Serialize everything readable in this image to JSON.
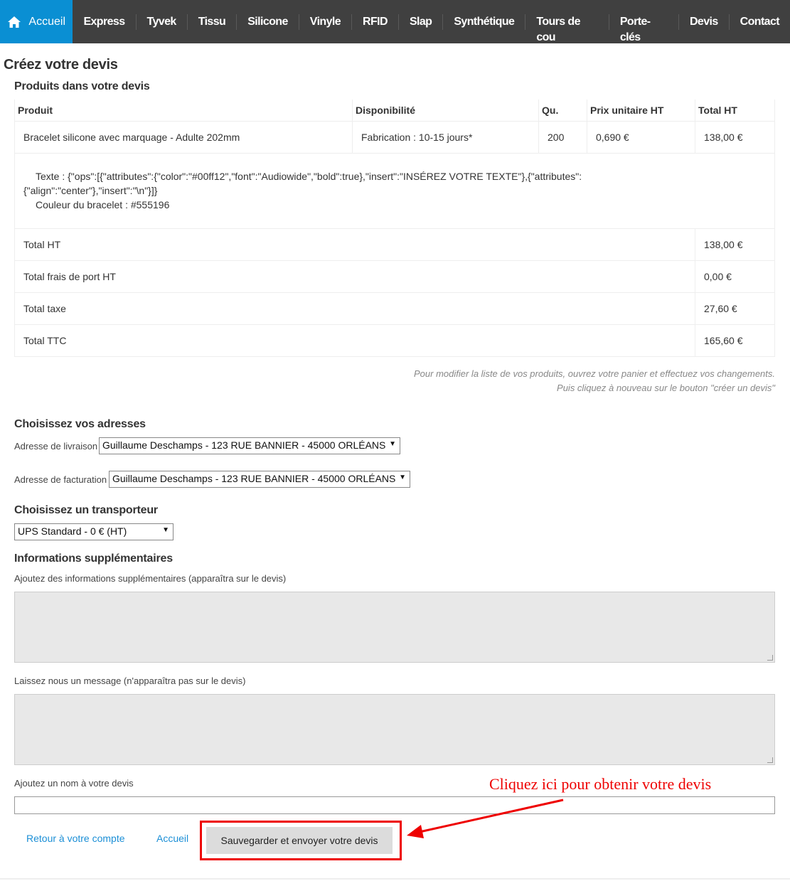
{
  "nav": {
    "home": "Accueil",
    "items": [
      "Express",
      "Tyvek",
      "Tissu",
      "Silicone",
      "Vinyle",
      "RFID",
      "Slap",
      "Synthétique",
      "Tours de cou",
      "Porte-clés",
      "Devis",
      "Contact"
    ]
  },
  "page_title": "Créez votre devis",
  "products_title": "Produits dans votre devis",
  "table": {
    "headers": [
      "Produit",
      "Disponibilité",
      "Qu.",
      "Prix unitaire HT",
      "Total HT"
    ],
    "row": [
      "Bracelet silicone avec marquage - Adulte 202mm",
      "Fabrication : 10-15 jours*",
      "200",
      "0,690 €",
      "138,00 €"
    ],
    "options_line1": "Texte : {\"ops\":[{\"attributes\":{\"color\":\"#00ff12\",\"font\":\"Audiowide\",\"bold\":true},\"insert\":\"INSÉREZ VOTRE TEXTE\"},{\"attributes\":",
    "options_line2": "{\"align\":\"center\"},\"insert\":\"\\n\"}]}",
    "options_line3": "Couleur du bracelet : #555196",
    "totals": [
      {
        "label": "Total HT",
        "value": "138,00 €"
      },
      {
        "label": "Total frais de port HT",
        "value": "0,00 €"
      },
      {
        "label": "Total taxe",
        "value": "27,60 €"
      },
      {
        "label": "Total TTC",
        "value": "165,60 €"
      }
    ]
  },
  "note_line1": "Pour modifier la liste de vos produits, ouvrez votre panier et effectuez vos changements.",
  "note_line2": "Puis cliquez à nouveau sur le bouton \"créer un devis\"",
  "addresses": {
    "title": "Choisissez vos adresses",
    "delivery_label": "Adresse de livraison",
    "delivery_value": "Guillaume Deschamps - 123 RUE BANNIER - 45000 ORLÉANS",
    "billing_label": "Adresse de facturation",
    "billing_value": "Guillaume Deschamps - 123 RUE BANNIER - 45000 ORLÉANS"
  },
  "carrier": {
    "title": "Choisissez un transporteur",
    "value": "UPS Standard - 0 € (HT)"
  },
  "extra": {
    "title": "Informations supplémentaires",
    "info_label": "Ajoutez des informations supplémentaires (apparaîtra sur le devis)",
    "message_label": "Laissez nous un message (n'apparaîtra pas sur le devis)",
    "name_label": "Ajoutez un nom à votre devis"
  },
  "actions": {
    "back": "Retour à votre compte",
    "home": "Accueil",
    "submit": "Sauvegarder et envoyer votre devis"
  },
  "callout": "Cliquez ici pour obtenir votre devis",
  "colors": {
    "nav_bg": "#404040",
    "home_bg": "#0a8fd3",
    "link": "#1c8fd6",
    "annotation": "#ee0000"
  }
}
